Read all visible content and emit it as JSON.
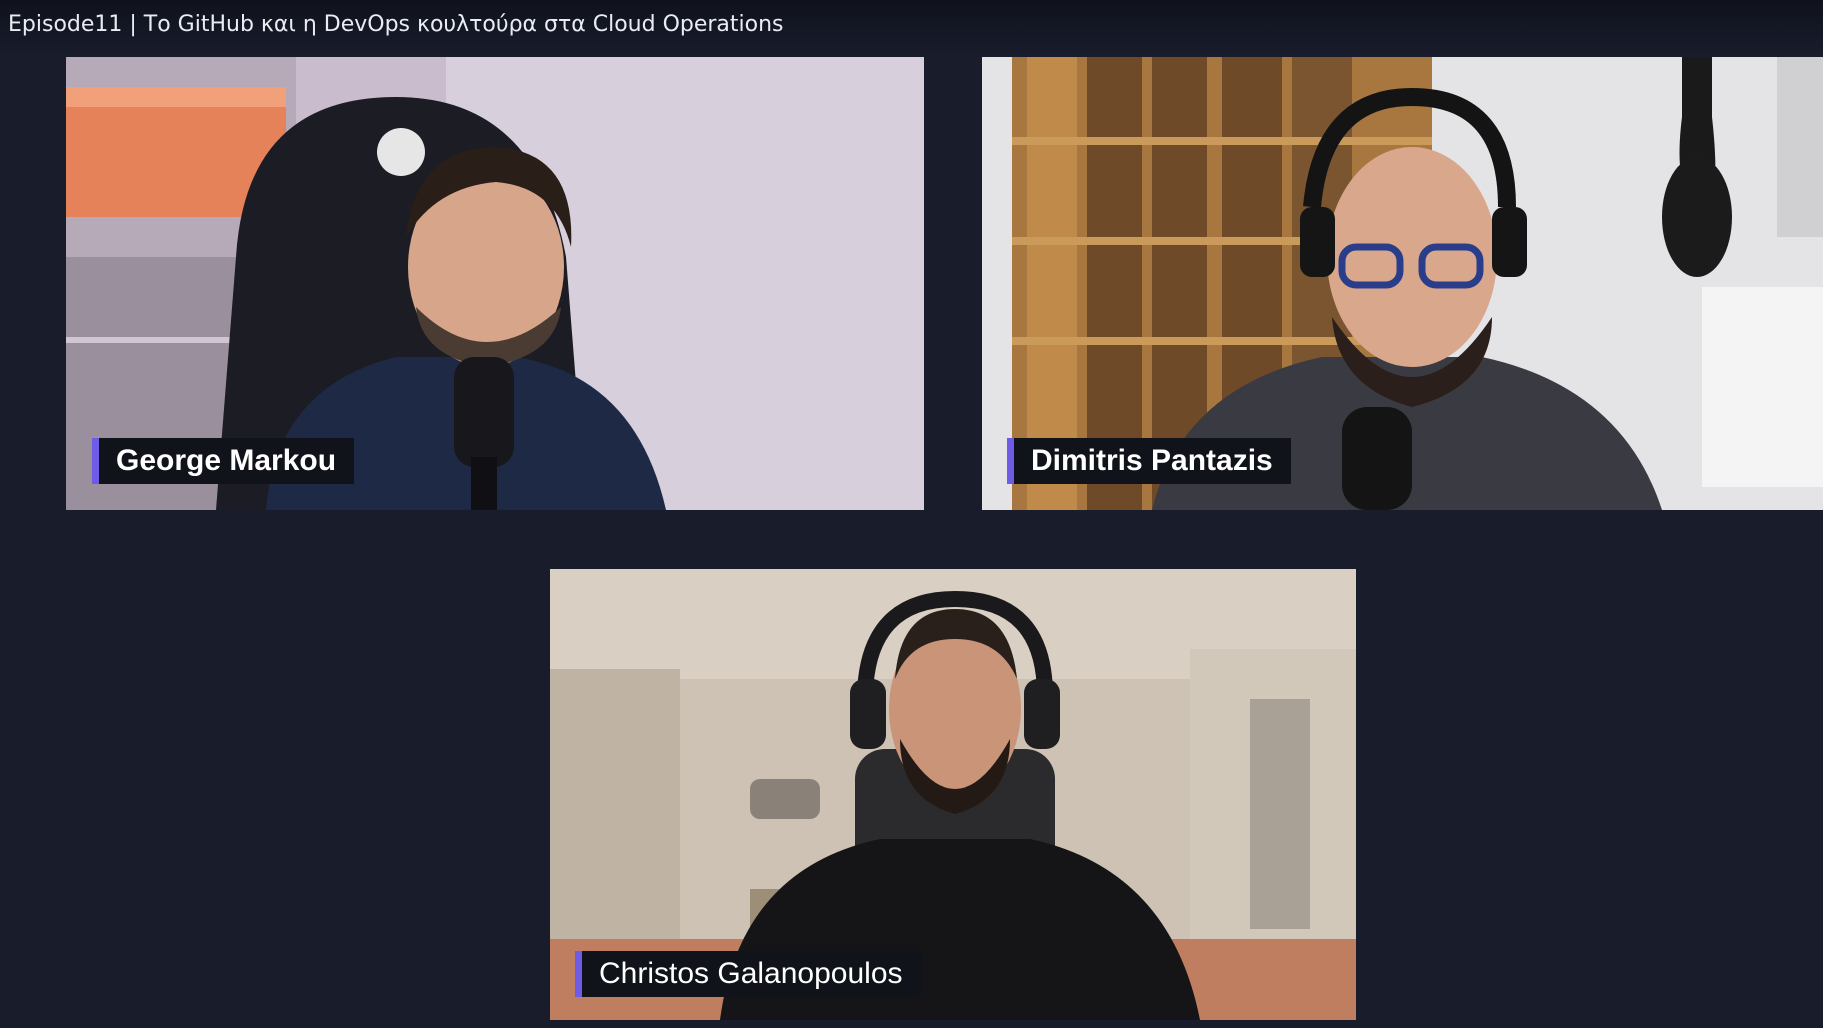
{
  "window": {
    "title": "Episode11 | Το GitHub και η DevOps κουλτούρα στα Cloud Operations"
  },
  "participants": [
    {
      "name": "George Markou"
    },
    {
      "name": "Dimitris Pantazis"
    },
    {
      "name": "Christos Galanopoulos"
    }
  ],
  "colors": {
    "background": "#181c2b",
    "nameplate_bg": "#11131a",
    "nameplate_accent": "#6f5ce6",
    "title_text": "#e9ecf2"
  }
}
